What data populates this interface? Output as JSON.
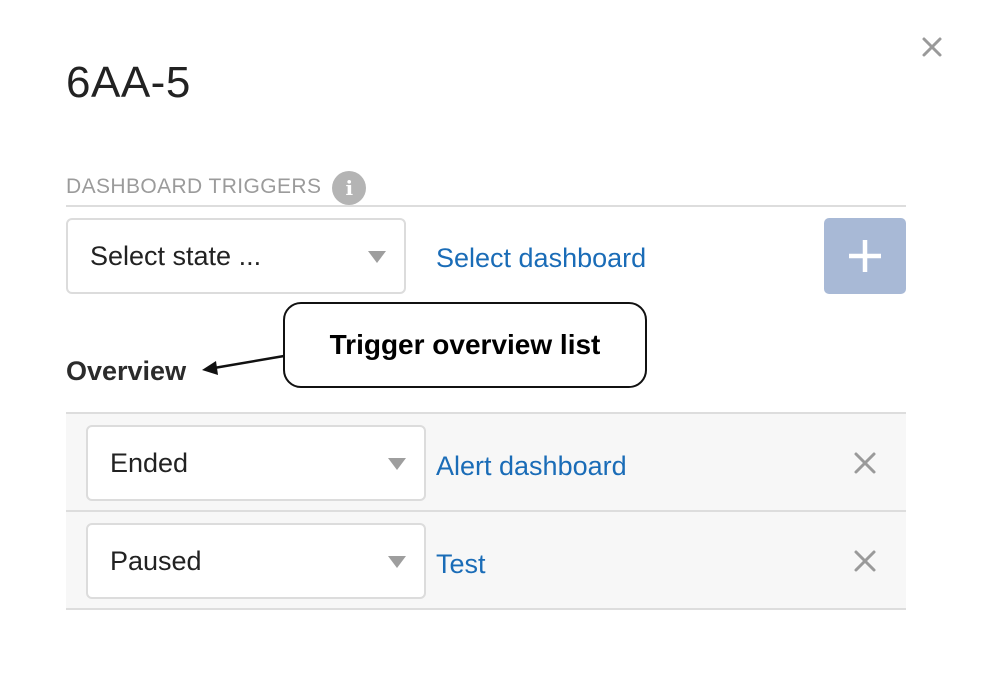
{
  "dialog": {
    "title": "6AA-5",
    "close_icon": "close-icon"
  },
  "triggers": {
    "section_label": "DASHBOARD TRIGGERS",
    "info_glyph": "i",
    "new_trigger": {
      "state_placeholder": "Select state ...",
      "dashboard_link": "Select dashboard",
      "add_icon": "plus-icon"
    }
  },
  "overview": {
    "heading": "Overview",
    "rows": [
      {
        "state": "Ended",
        "dashboard": "Alert dashboard"
      },
      {
        "state": "Paused",
        "dashboard": "Test"
      }
    ]
  },
  "annotation": {
    "callout_text": "Trigger overview list"
  },
  "colors": {
    "link": "#1a6cb7",
    "add_button": "#a8b9d6",
    "muted_label": "#9b9b9b",
    "row_background": "#f7f7f7"
  }
}
